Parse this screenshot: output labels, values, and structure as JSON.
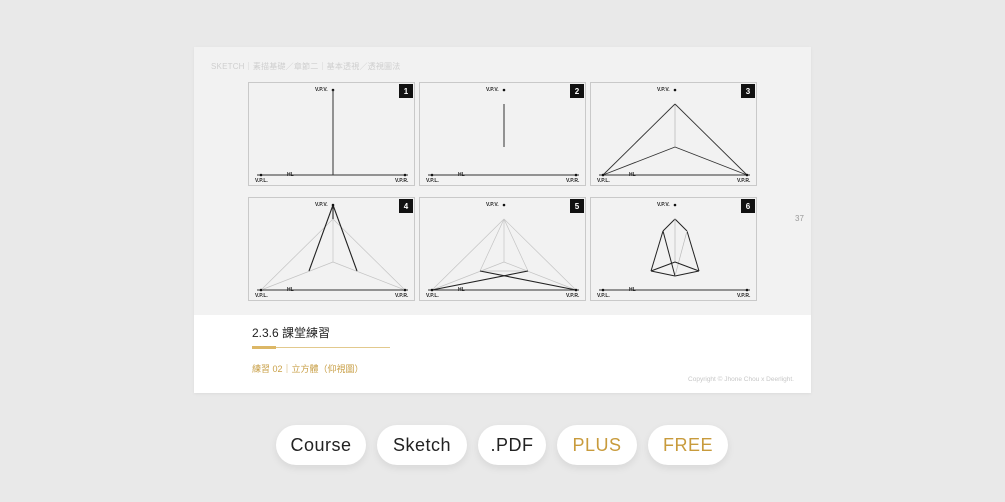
{
  "breadcrumb": "SKETCH｜素描基礎／章節二｜基本透視／透視圖法",
  "page_number": "37",
  "panels": [
    {
      "badge": "1",
      "vpv": "V.P.V.",
      "hl": "HL",
      "vpl": "V.P.L.",
      "vpr": "V.P.R."
    },
    {
      "badge": "2",
      "vpv": "V.P.V.",
      "hl": "HL",
      "vpl": "V.P.L.",
      "vpr": "V.P.R."
    },
    {
      "badge": "3",
      "vpv": "V.P.V.",
      "hl": "HL",
      "vpl": "V.P.L.",
      "vpr": "V.P.R."
    },
    {
      "badge": "4",
      "vpv": "V.P.V.",
      "hl": "HL",
      "vpl": "V.P.L.",
      "vpr": "V.P.R."
    },
    {
      "badge": "5",
      "vpv": "V.P.V.",
      "hl": "HL",
      "vpl": "V.P.L.",
      "vpr": "V.P.R."
    },
    {
      "badge": "6",
      "vpv": "V.P.V.",
      "hl": "HL",
      "vpl": "V.P.L.",
      "vpr": "V.P.R."
    }
  ],
  "section_title": "2.3.6 課堂練習",
  "subtitle": "練習 02｜立方體（仰視圖）",
  "copyright": "Copyright © Jhone Chou x Deerlight.",
  "buttons": [
    {
      "label": "Course",
      "color": "#222222"
    },
    {
      "label": "Sketch",
      "color": "#222222"
    },
    {
      "label": ".PDF",
      "color": "#222222"
    },
    {
      "label": "PLUS",
      "color": "#c89b3c"
    },
    {
      "label": "FREE",
      "color": "#c89b3c"
    }
  ],
  "colors": {
    "accent": "#dcb766",
    "background": "#e9e9e9"
  }
}
